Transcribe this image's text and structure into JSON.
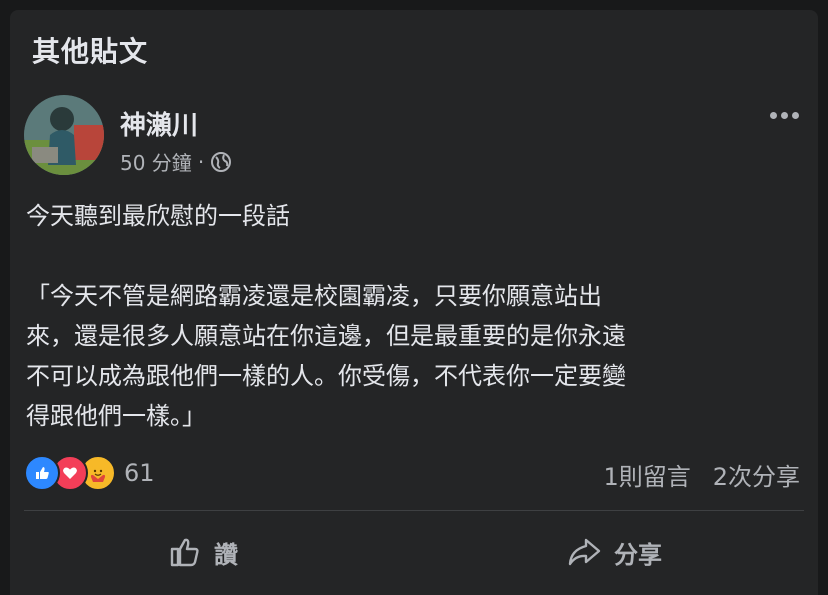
{
  "section": {
    "title": "其他貼文"
  },
  "post": {
    "author": "神瀨川",
    "time": "50 分鐘",
    "separator": "·",
    "privacy_icon": "globe-icon",
    "text_lines": [
      "今天聽到最欣慰的一段話",
      "",
      "「今天不管是網路霸凌還是校園霸凌，只要你願意站出",
      "來，還是很多人願意站在你這邊，但是最重要的是你永遠",
      "不可以成為跟他們一樣的人。你受傷，不代表你一定要變",
      "得跟他們一樣。」"
    ],
    "reactions": {
      "icons": [
        "like-icon",
        "love-icon",
        "care-icon"
      ],
      "count": "61"
    },
    "comments": "1則留言",
    "shares": "2次分享"
  },
  "actions": {
    "like_label": "讚",
    "share_label": "分享"
  },
  "colors": {
    "like": "#2d88ff",
    "love": "#f33e58",
    "care": "#f7b928",
    "background": "#242526"
  }
}
